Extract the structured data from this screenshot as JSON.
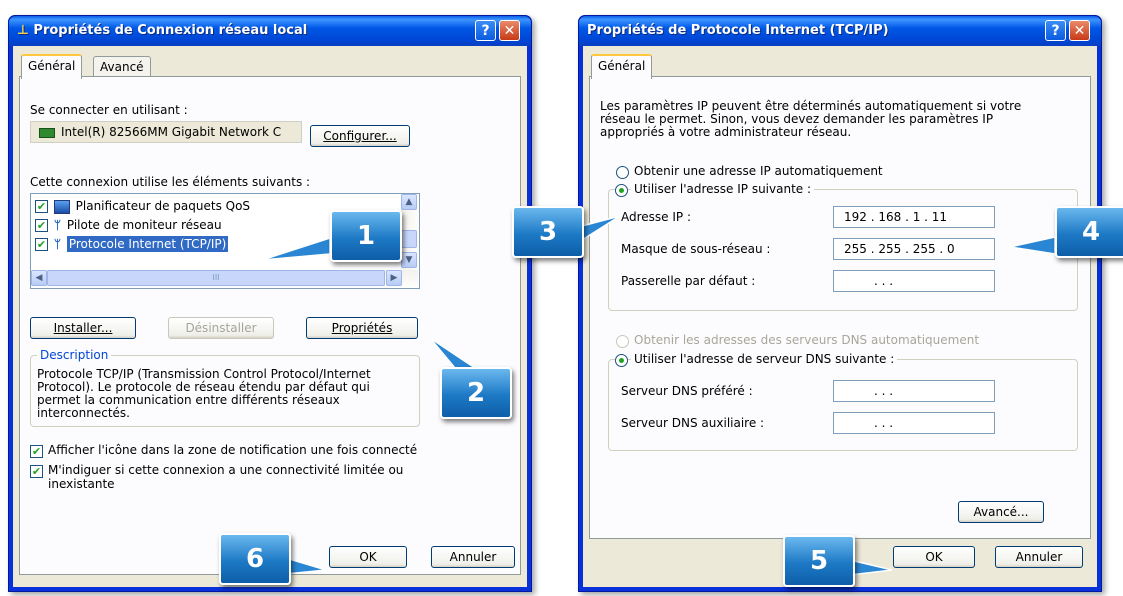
{
  "left_dialog": {
    "title": "Propriétés de Connexion réseau local",
    "help_glyph": "?",
    "close_glyph": "✕",
    "tabs": [
      "Général",
      "Avancé"
    ],
    "connect_using_label": "Se connecter en utilisant :",
    "adapter_name": "Intel(R) 82566MM Gigabit Network C",
    "configure_button": "Configurer...",
    "components_label": "Cette connexion utilise les éléments suivants :",
    "components": [
      {
        "label": "Planificateur de paquets QoS",
        "checked": true,
        "icon": "qos-scheduler-icon"
      },
      {
        "label": "Pilote de moniteur réseau",
        "checked": true,
        "icon": "network-driver-icon"
      },
      {
        "label": "Protocole Internet (TCP/IP)",
        "checked": true,
        "icon": "network-protocol-icon",
        "selected": true
      }
    ],
    "hscroll_grip": "III",
    "install_button": "Installer...",
    "uninstall_button": "Désinstaller",
    "properties_button": "Propriétés",
    "description_group": "Description",
    "description_text": "Protocole TCP/IP (Transmission Control Protocol/Internet Protocol). Le protocole de réseau étendu par défaut qui permet la communication entre différents réseaux interconnectés.",
    "show_icon_label": "Afficher l'icône dans la zone de notification une fois connecté",
    "notify_label_line1": "M'indiguer si cette connexion a une connectivité limitée ou",
    "notify_label_line2": "inexistante",
    "ok_button": "OK",
    "cancel_button": "Annuler"
  },
  "right_dialog": {
    "title": "Propriétés de Protocole Internet (TCP/IP)",
    "help_glyph": "?",
    "close_glyph": "✕",
    "tab": "Général",
    "intro_line1": "Les paramètres IP peuvent être déterminés automatiquement si votre",
    "intro_line2": "réseau le permet. Sinon, vous devez demander les paramètres IP",
    "intro_line3": "appropriés à votre administrateur réseau.",
    "auto_ip_label": "Obtenir une adresse IP automatiquement",
    "manual_ip_label": "Utiliser l'adresse IP suivante :",
    "ip_address_label": "Adresse IP :",
    "ip_address_value": "192 . 168 .  1  . 11",
    "subnet_label": "Masque de sous-réseau :",
    "subnet_value": "255 . 255 . 255 .  0",
    "gateway_label": "Passerelle par défaut :",
    "gateway_value": ".     .     .",
    "auto_dns_label": "Obtenir les adresses des serveurs DNS automatiquement",
    "manual_dns_label": "Utiliser l'adresse de serveur DNS suivante :",
    "preferred_dns_label": "Serveur DNS préféré :",
    "preferred_dns_value": ".     .     .",
    "alternate_dns_label": "Serveur DNS auxiliaire :",
    "alternate_dns_value": ".     .     .",
    "advanced_button": "Avancé...",
    "ok_button": "OK",
    "cancel_button": "Annuler"
  },
  "callouts": [
    "1",
    "2",
    "3",
    "4",
    "5",
    "6"
  ],
  "colors": {
    "titlebar": "#0054e3",
    "callout": "#2a86d3",
    "dialog_bg": "#ece9d8",
    "selection": "#316ac5"
  }
}
